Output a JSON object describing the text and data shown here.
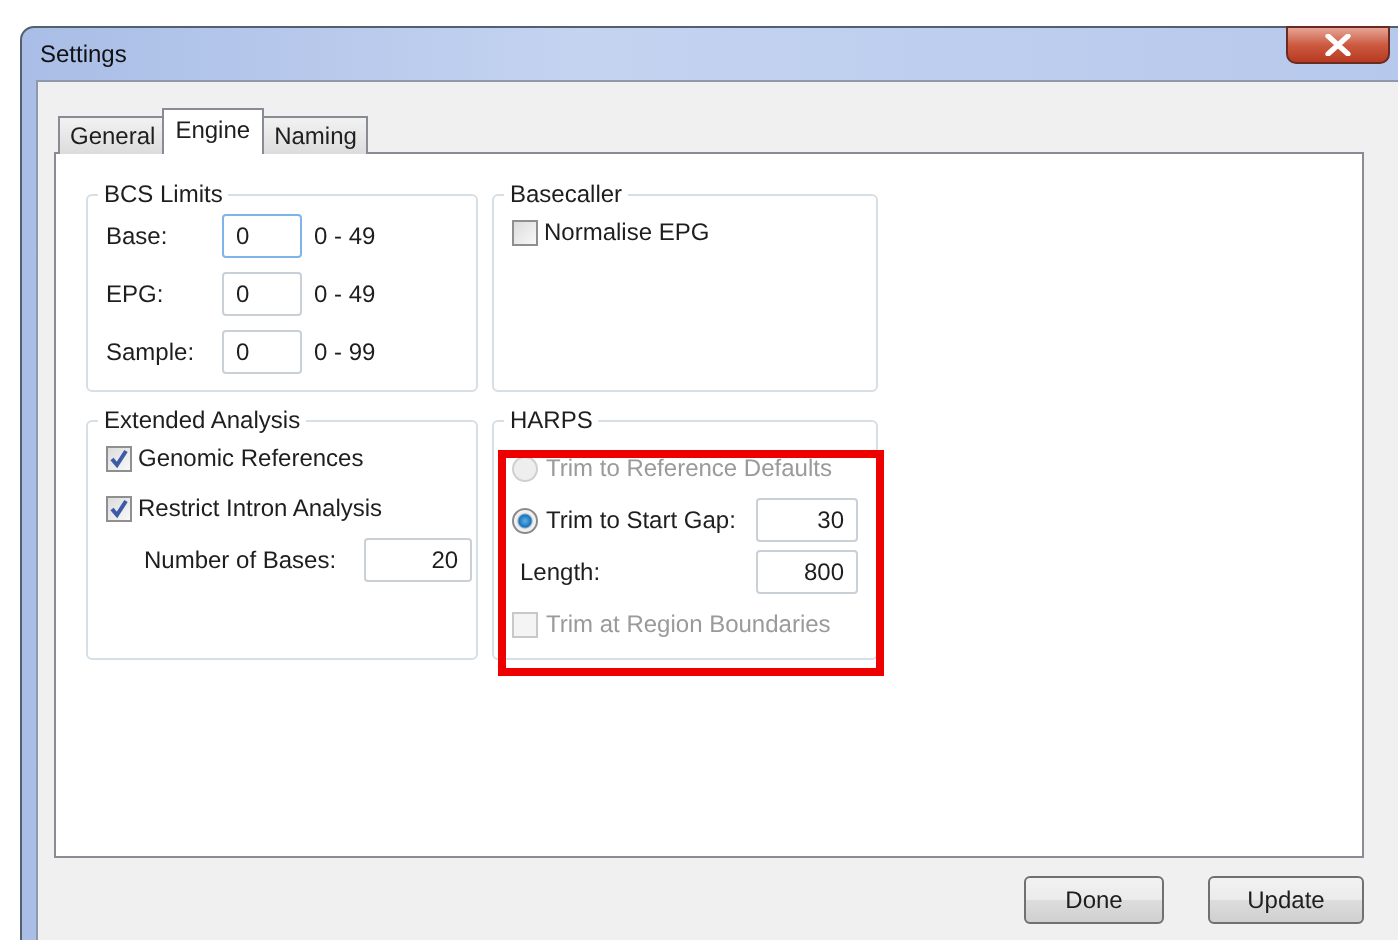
{
  "window": {
    "title": "Settings"
  },
  "tabs": [
    {
      "label": "General",
      "selected": false
    },
    {
      "label": "Engine",
      "selected": true
    },
    {
      "label": "Naming",
      "selected": false
    }
  ],
  "bcs_limits": {
    "title": "BCS Limits",
    "rows": [
      {
        "label": "Base:",
        "value": "0",
        "range": "0 - 49",
        "focused": true
      },
      {
        "label": "EPG:",
        "value": "0",
        "range": "0 - 49",
        "focused": false
      },
      {
        "label": "Sample:",
        "value": "0",
        "range": "0 - 99",
        "focused": false
      }
    ]
  },
  "basecaller": {
    "title": "Basecaller",
    "options": [
      {
        "label": "Normalise EPG",
        "checked": false
      }
    ]
  },
  "extended_analysis": {
    "title": "Extended Analysis",
    "options": [
      {
        "label": "Genomic References",
        "checked": true
      },
      {
        "label": "Restrict Intron Analysis",
        "checked": true
      }
    ],
    "number_field": {
      "label": "Number of Bases:",
      "value": "20"
    }
  },
  "harps": {
    "title": "HARPS",
    "highlighted": true,
    "options": [
      {
        "kind": "radio",
        "label": "Trim to Reference Defaults",
        "selected": false,
        "disabled": true
      },
      {
        "kind": "radio",
        "label": "Trim to Start Gap:",
        "selected": true,
        "disabled": false,
        "value": "30"
      },
      {
        "kind": "field",
        "label": "Length:",
        "value": "800"
      },
      {
        "kind": "checkbox",
        "label": "Trim at Region Boundaries",
        "checked": false,
        "disabled": true
      }
    ]
  },
  "buttons": [
    "Done",
    "Update"
  ]
}
